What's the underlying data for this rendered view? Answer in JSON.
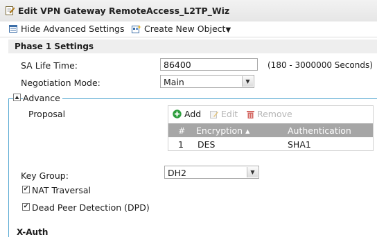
{
  "window": {
    "title": "Edit VPN Gateway RemoteAccess_L2TP_Wiz"
  },
  "toolbar": {
    "hide_advanced": "Hide Advanced Settings",
    "create_new": "Create New Object",
    "create_caret": "▼"
  },
  "phase1": {
    "header": "Phase 1 Settings",
    "sa_life_label": "SA Life Time:",
    "sa_life_value": "86400",
    "sa_life_range": "(180 - 3000000 Seconds)",
    "negotiation_label": "Negotiation Mode:",
    "negotiation_value": "Main"
  },
  "advance": {
    "legend": "Advance",
    "proposal_label": "Proposal",
    "grid_toolbar": {
      "add": "Add",
      "edit": "Edit",
      "remove": "Remove"
    },
    "columns": {
      "num": "#",
      "encryption": "Encryption ▴",
      "authentication": "Authentication"
    },
    "rows": [
      {
        "num": "1",
        "encryption": "DES",
        "authentication": "SHA1"
      }
    ],
    "key_group_label": "Key Group:",
    "key_group_value": "DH2",
    "nat_traversal_label": "NAT Traversal",
    "nat_traversal_checked": true,
    "dpd_label": "Dead Peer Detection (DPD)",
    "dpd_checked": true
  },
  "xauth": {
    "header": "X-Auth"
  },
  "colors": {
    "accent_line": "#58a9d2",
    "add_green": "#2e9e3e",
    "remove_red": "#c8463f",
    "grid_header": "#a6a6a6"
  }
}
